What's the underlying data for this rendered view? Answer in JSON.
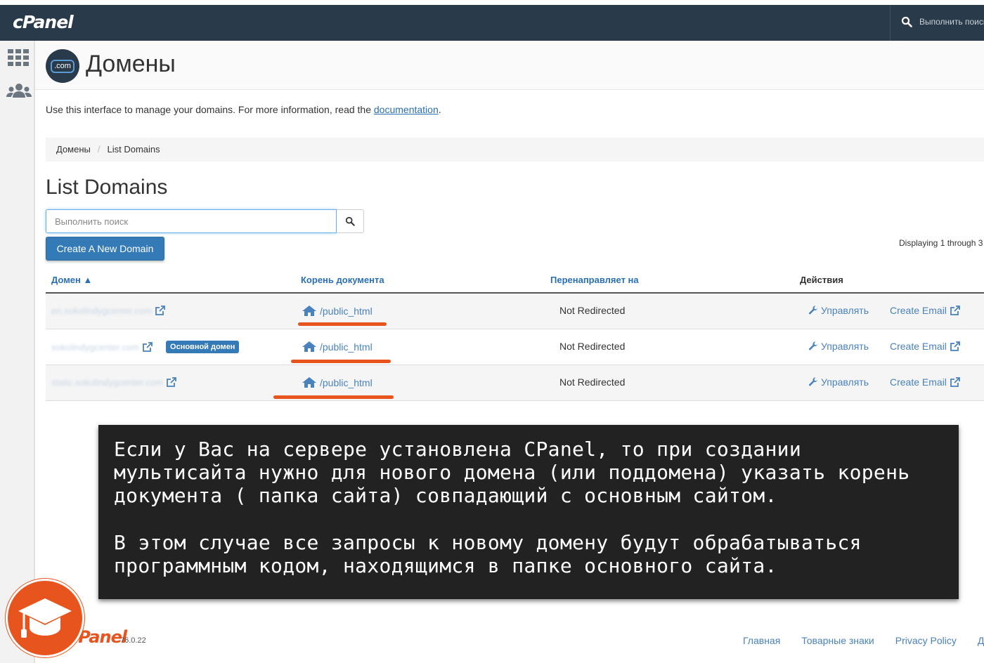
{
  "app": {
    "logo": "cPanel"
  },
  "topbar": {
    "search_placeholder": "Выполнить поиск"
  },
  "header": {
    "badge_text": ".com",
    "title": "Домены"
  },
  "intro": {
    "text": "Use this interface to manage your domains. For more information, read the ",
    "link": "documentation",
    "end": "."
  },
  "breadcrumb": {
    "items": [
      "Домены",
      "List Domains"
    ],
    "separator": "/"
  },
  "section_title": "List Domains",
  "search": {
    "placeholder": "Выполнить поиск"
  },
  "create_button": "Create A New Domain",
  "displaying": "Displaying 1 through 3",
  "table": {
    "headers": {
      "domain": "Домен ▲",
      "docroot": "Корень документа",
      "redirect": "Перенаправляет на",
      "actions": "Действия"
    },
    "rows": [
      {
        "domain": "en.sokolindygcenter.com",
        "badge": "",
        "docroot": "/public_html",
        "redirect": "Not Redirected",
        "manage": "Управлять",
        "email": "Create Email"
      },
      {
        "domain": "sokolindygcenter.com",
        "badge": "Основной домен",
        "docroot": "/public_html",
        "redirect": "Not Redirected",
        "manage": "Управлять",
        "email": "Create Email"
      },
      {
        "domain": "static.sokolindygcenter.com",
        "badge": "",
        "docroot": "/public_html",
        "redirect": "Not Redirected",
        "manage": "Управлять",
        "email": "Create Email"
      }
    ]
  },
  "annotation": {
    "p1": "Если у Вас на сервере установлена CPanel, то при создании мультисайта нужно для нового домена (или поддомена) указать корень документа ( папка сайта) совпадающий с основным сайтом.",
    "p2": "В этом случае все запросы к новому домену будут обрабатываться программным кодом, находящимся в папке основного сайта."
  },
  "footer": {
    "logo": "cPanel",
    "version": "76.0.22",
    "links": [
      "Главная",
      "Товарные знаки",
      "Privacy Policy",
      "Д"
    ]
  },
  "colors": {
    "topbar": "#293a4a",
    "accent": "#e8541e",
    "link": "#4a82bd",
    "primary": "#337ab7"
  }
}
